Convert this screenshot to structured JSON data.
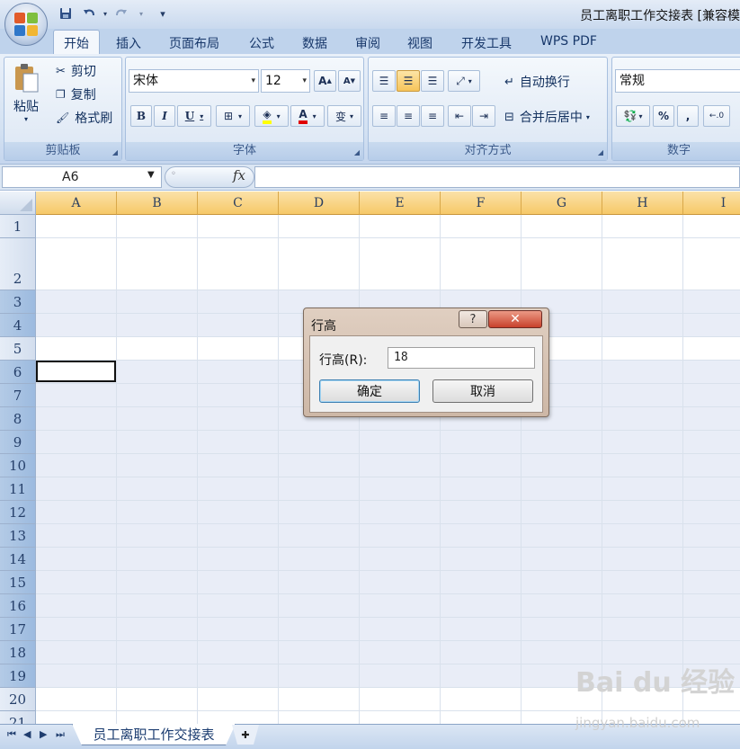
{
  "window": {
    "title": "员工离职工作交接表  [兼容模"
  },
  "quick_access": {
    "save": "save-icon",
    "undo": "undo-icon",
    "redo": "redo-icon",
    "dropdown": "▾"
  },
  "tabs": [
    "开始",
    "插入",
    "页面布局",
    "公式",
    "数据",
    "审阅",
    "视图",
    "开发工具",
    "WPS PDF"
  ],
  "ribbon": {
    "clipboard": {
      "paste": "粘贴",
      "cut": "剪切",
      "copy": "复制",
      "format_painter": "格式刷",
      "label": "剪贴板"
    },
    "font": {
      "name": "宋体",
      "size": "12",
      "grow": "A",
      "shrink": "A",
      "bold": "B",
      "italic": "I",
      "underline": "U",
      "font_color": "A",
      "phonetic": "变",
      "label": "字体"
    },
    "alignment": {
      "wrap_text": "自动换行",
      "merge_center": "合并后居中",
      "label": "对齐方式"
    },
    "number": {
      "format": "常规",
      "percent": "%",
      "comma": ",",
      "label": "数字"
    }
  },
  "formula_bar": {
    "name_box": "A6",
    "fx": "fx",
    "content": ""
  },
  "grid": {
    "columns": [
      "A",
      "B",
      "C",
      "D",
      "E",
      "F",
      "G",
      "H",
      "I"
    ],
    "rows": [
      "1",
      "2",
      "3",
      "4",
      "5",
      "6",
      "7",
      "8",
      "9",
      "10",
      "11",
      "12",
      "13",
      "14",
      "15",
      "16",
      "17",
      "18",
      "19",
      "20",
      "21"
    ]
  },
  "sheet_tabs": {
    "active": "员工离职工作交接表"
  },
  "dialog": {
    "title": "行高",
    "help": "?",
    "close": "✕",
    "label": "行高(R):",
    "value": "18",
    "ok": "确定",
    "cancel": "取消"
  },
  "watermark": {
    "brand": "Bai du 经验",
    "url": "jingyan.baidu.com"
  },
  "colors": {
    "accent": "#f6c968",
    "ribbon": "#d3e1f2",
    "selected_row": "#e9edf7"
  }
}
